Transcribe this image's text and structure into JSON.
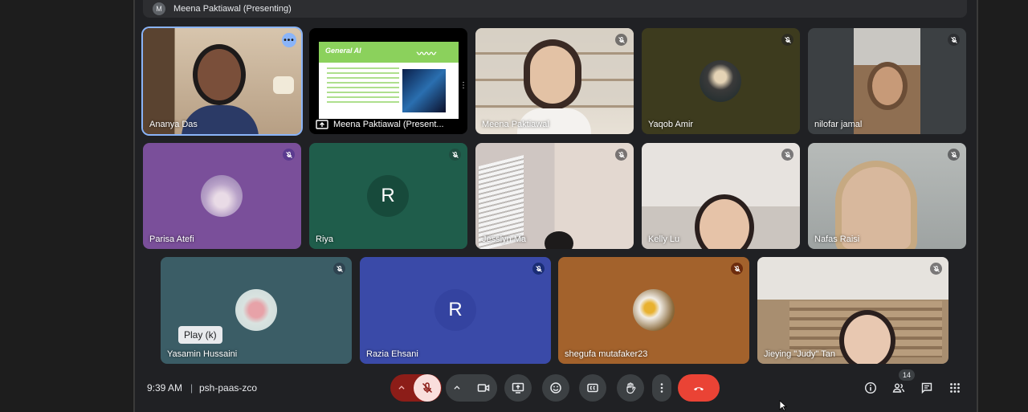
{
  "presenting_bar": {
    "avatar_letter": "M",
    "text": "Meena Paktiawal (Presenting)"
  },
  "slide": {
    "title": "General AI"
  },
  "tiles": [
    {
      "name": "Ananya Das"
    },
    {
      "name": "Meena Paktiawal (Present..."
    },
    {
      "name": "Meena Paktiawal"
    },
    {
      "name": "Yaqob Amir"
    },
    {
      "name": "nilofar jamal"
    },
    {
      "name": "Parisa Atefi"
    },
    {
      "name": "Riya",
      "letter": "R"
    },
    {
      "name": "Jesslyn Ma"
    },
    {
      "name": "Kelly Lu"
    },
    {
      "name": "Nafas Raisi"
    },
    {
      "name": "Yasamin Hussaini"
    },
    {
      "name": "Razia Ehsani",
      "letter": "R"
    },
    {
      "name": "shegufa mutafaker23"
    },
    {
      "name": "Jieying \"Judy\" Tan"
    }
  ],
  "tooltip": "Play (k)",
  "meeting": {
    "time": "9:39 AM",
    "code": "psh-paas-zco"
  },
  "participants_count": "14",
  "colors": {
    "end_call": "#ea4335",
    "speaking_ring": "#8ab4f8"
  }
}
